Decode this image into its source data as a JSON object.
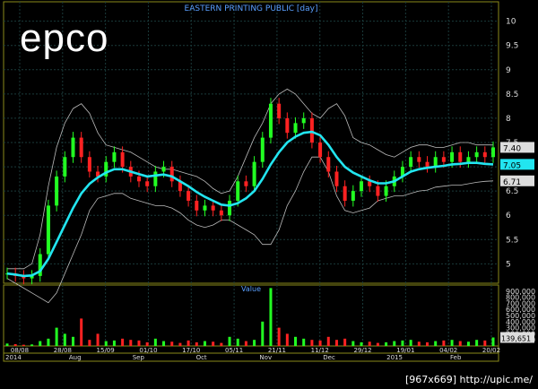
{
  "chart_data": {
    "type": "candlestick",
    "title": "EASTERN PRINTING PUBLIC [day]",
    "symbol": "epco",
    "price_axis": {
      "ticks": [
        5,
        5.5,
        6,
        6.5,
        7,
        7.5,
        8,
        8.5,
        9,
        9.5,
        10
      ],
      "ylim": [
        4.6,
        10.4
      ]
    },
    "volume_axis": {
      "label": "Value",
      "ticks": [
        "900,000",
        "800,000",
        "700,000",
        "600,000",
        "500,000",
        "400,000",
        "300,000",
        "200,000",
        "100,000"
      ],
      "ylim": [
        0,
        1000000
      ]
    },
    "price_badges": [
      {
        "label": "7.40",
        "value": 7.4,
        "color": "#dddddd"
      },
      {
        "label": "7.05",
        "value": 7.05,
        "color": "#22e5f0"
      },
      {
        "label": "6.71",
        "value": 6.71,
        "color": "#dddddd"
      }
    ],
    "volume_badge": {
      "label": "139,651",
      "value": 139651
    },
    "x_ticks": [
      "08/08",
      "28/08",
      "15/09",
      "01/10",
      "17/10",
      "05/11",
      "21/11",
      "11/12",
      "29/12",
      "19/01",
      "04/02",
      "20/02"
    ],
    "period_labels": [
      "2014",
      "Aug",
      "Sep",
      "Oct",
      "Nov",
      "Dec",
      "2015",
      "Feb"
    ],
    "close_series": [
      4.8,
      4.75,
      4.7,
      4.75,
      5.2,
      6.2,
      6.8,
      7.2,
      7.6,
      7.2,
      6.9,
      6.8,
      7.1,
      7.3,
      7.0,
      6.8,
      6.7,
      6.6,
      6.9,
      7.0,
      6.7,
      6.5,
      6.3,
      6.1,
      6.2,
      6.1,
      6.0,
      6.3,
      6.7,
      6.6,
      7.1,
      7.6,
      8.3,
      8.0,
      7.7,
      7.9,
      8.0,
      7.5,
      7.2,
      6.9,
      6.6,
      6.3,
      6.5,
      6.7,
      6.6,
      6.4,
      6.6,
      6.8,
      7.0,
      7.2,
      7.1,
      7.0,
      7.2,
      7.1,
      7.3,
      7.1,
      7.2,
      7.3,
      7.2,
      7.4
    ],
    "ma_series": [
      4.8,
      4.78,
      4.75,
      4.76,
      4.85,
      5.1,
      5.45,
      5.8,
      6.15,
      6.45,
      6.65,
      6.78,
      6.88,
      6.95,
      6.95,
      6.9,
      6.85,
      6.8,
      6.82,
      6.84,
      6.8,
      6.7,
      6.6,
      6.48,
      6.38,
      6.3,
      6.22,
      6.2,
      6.25,
      6.35,
      6.5,
      6.75,
      7.05,
      7.3,
      7.5,
      7.62,
      7.7,
      7.72,
      7.65,
      7.45,
      7.2,
      7.0,
      6.88,
      6.8,
      6.72,
      6.66,
      6.66,
      6.7,
      6.8,
      6.9,
      6.95,
      6.98,
      7.0,
      7.02,
      7.05,
      7.06,
      7.08,
      7.08,
      7.06,
      7.05
    ],
    "upper_band": [
      4.9,
      4.9,
      4.9,
      5.0,
      5.6,
      6.6,
      7.4,
      7.9,
      8.2,
      8.3,
      8.1,
      7.7,
      7.45,
      7.4,
      7.35,
      7.3,
      7.2,
      7.1,
      7.0,
      6.95,
      6.95,
      6.9,
      6.85,
      6.8,
      6.7,
      6.55,
      6.45,
      6.5,
      6.8,
      7.2,
      7.6,
      7.9,
      8.3,
      8.5,
      8.6,
      8.5,
      8.3,
      8.1,
      8.0,
      8.2,
      8.3,
      8.05,
      7.6,
      7.5,
      7.45,
      7.35,
      7.25,
      7.2,
      7.3,
      7.4,
      7.45,
      7.45,
      7.4,
      7.4,
      7.45,
      7.5,
      7.5,
      7.45,
      7.45,
      7.45
    ],
    "lower_band": [
      4.7,
      4.6,
      4.5,
      4.4,
      4.3,
      4.2,
      4.4,
      4.8,
      5.2,
      5.6,
      6.1,
      6.35,
      6.4,
      6.45,
      6.45,
      6.35,
      6.3,
      6.25,
      6.2,
      6.2,
      6.15,
      6.05,
      5.9,
      5.8,
      5.75,
      5.8,
      5.9,
      5.9,
      5.8,
      5.7,
      5.6,
      5.4,
      5.4,
      5.7,
      6.2,
      6.5,
      6.9,
      7.2,
      7.2,
      6.9,
      6.4,
      6.1,
      6.05,
      6.1,
      6.15,
      6.3,
      6.35,
      6.4,
      6.4,
      6.45,
      6.5,
      6.52,
      6.58,
      6.6,
      6.62,
      6.62,
      6.65,
      6.68,
      6.7,
      6.71
    ],
    "volume_series": [
      40000,
      30000,
      20000,
      25000,
      80000,
      120000,
      300000,
      200000,
      150000,
      450000,
      100000,
      200000,
      80000,
      90000,
      120000,
      100000,
      90000,
      60000,
      120000,
      80000,
      70000,
      50000,
      90000,
      60000,
      80000,
      70000,
      50000,
      150000,
      120000,
      80000,
      100000,
      400000,
      950000,
      300000,
      200000,
      150000,
      120000,
      100000,
      90000,
      150000,
      100000,
      120000,
      80000,
      60000,
      70000,
      50000,
      60000,
      80000,
      90000,
      100000,
      70000,
      60000,
      80000,
      90000,
      100000,
      80000,
      70000,
      100000,
      90000,
      139651
    ],
    "colors": {
      "up": "#22ff22",
      "down": "#ff2222",
      "ma": "#22e5f0",
      "band": "#bbbbbb",
      "frame": "#8a8a1a",
      "grid": "#1a3a3a",
      "text": "#dddddd",
      "title": "#5aa0ff"
    }
  },
  "footer_label": "[967x669] http://upic.me/"
}
